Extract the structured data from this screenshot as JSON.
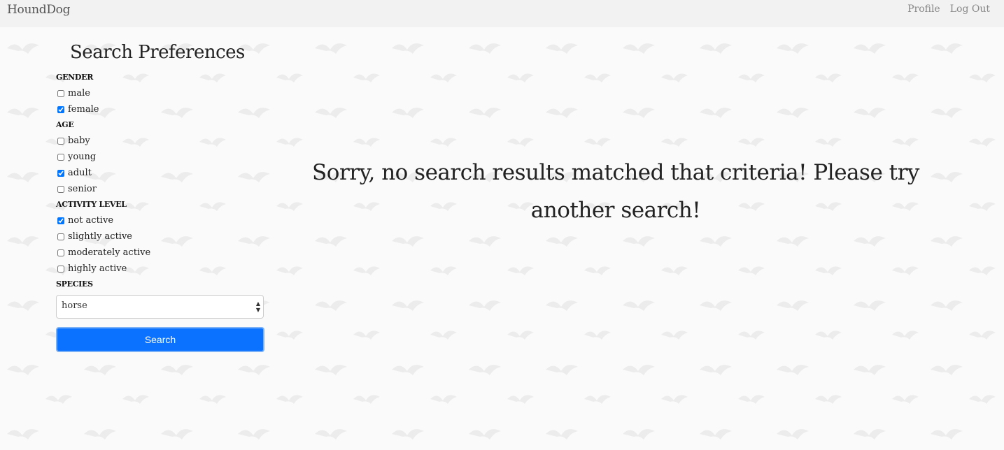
{
  "navbar": {
    "brand": "HoundDog",
    "links": [
      "Profile",
      "Log Out"
    ]
  },
  "sidebar": {
    "title": "Search Preferences",
    "groups": [
      {
        "heading": "GENDER",
        "options": [
          {
            "label": "male",
            "checked": false
          },
          {
            "label": "female",
            "checked": true
          }
        ]
      },
      {
        "heading": "AGE",
        "options": [
          {
            "label": "baby",
            "checked": false
          },
          {
            "label": "young",
            "checked": false
          },
          {
            "label": "adult",
            "checked": true
          },
          {
            "label": "senior",
            "checked": false
          }
        ]
      },
      {
        "heading": "ACTIVITY LEVEL",
        "options": [
          {
            "label": "not active",
            "checked": true
          },
          {
            "label": "slightly active",
            "checked": false
          },
          {
            "label": "moderately active",
            "checked": false
          },
          {
            "label": "highly active",
            "checked": false
          }
        ]
      }
    ],
    "species": {
      "heading": "SPECIES",
      "selected": "horse"
    },
    "search_label": "Search"
  },
  "main": {
    "message": "Sorry, no search results matched that criteria! Please try another search!"
  },
  "colors": {
    "accent": "#0a72ff",
    "background": "#fafafa",
    "navbar": "#f2f2f2"
  }
}
